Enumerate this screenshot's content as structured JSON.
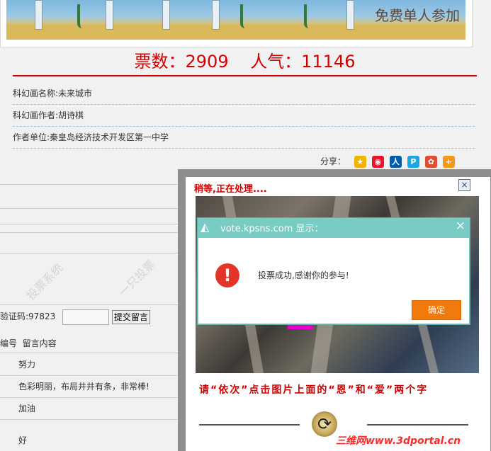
{
  "painting": {
    "handwriting": "免费单人参加"
  },
  "votes": {
    "votes_label": "票数：",
    "votes_value": "2909",
    "popularity_label": "人气：",
    "popularity_value": "11146"
  },
  "details": [
    {
      "label": "科幻画名称:",
      "value": "未来城市"
    },
    {
      "label": "科幻画作者:",
      "value": "胡诗棋"
    },
    {
      "label": "作者单位:",
      "value": "秦皇岛经济技术开发区第一中学"
    }
  ],
  "share": {
    "label": "分享：",
    "icons": [
      "qzone-icon",
      "weibo-icon",
      "renren-icon",
      "pengyou-icon",
      "tencent-weibo-icon",
      "more-share-icon"
    ]
  },
  "watermark": {
    "left": "投票系统",
    "right": "一只投票"
  },
  "comment_form": {
    "captcha_label": "验证码:97823",
    "captcha_value": "",
    "submit_label": "提交留言"
  },
  "comments": {
    "columns": [
      "编号",
      "留言内容"
    ],
    "rows": [
      "努力",
      "色彩明丽，布局井井有条，非常棒!",
      "加油",
      "好"
    ]
  },
  "processing_panel": {
    "title": "稍等,正在处理....",
    "close_label": "×",
    "instruction": "请“依次”点击图片上面的“恩”和“爱”两个字",
    "refresh_icon": "refresh-icon"
  },
  "alert_dialog": {
    "title": "vote.kpsns.com 显示：",
    "close_label": "×",
    "message": "投票成功,感谢你的参与!",
    "ok_label": "确定"
  },
  "brand_watermark": "三维网www.3dportal.cn",
  "colors": {
    "accent_red": "#d40000",
    "dialog_teal": "#78ccc4",
    "ok_orange": "#f07a0b"
  }
}
